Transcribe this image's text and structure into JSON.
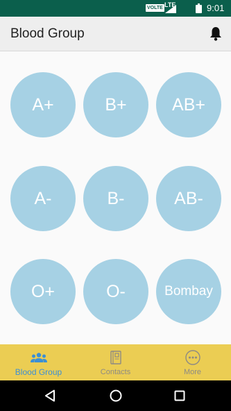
{
  "status_bar": {
    "volte": "VOLTE",
    "network": "LTE",
    "time": "9:01",
    "icons": [
      "volte-icon",
      "signal-icon",
      "battery-icon"
    ]
  },
  "app_bar": {
    "title": "Blood Group",
    "notification_icon": "bell-icon"
  },
  "blood_groups": [
    "A+",
    "B+",
    "AB+",
    "A-",
    "B-",
    "AB-",
    "O+",
    "O-",
    "Bombay"
  ],
  "bottom_nav": {
    "items": [
      {
        "label": "Blood Group",
        "icon": "people-icon",
        "active": true
      },
      {
        "label": "Contacts",
        "icon": "contacts-book-icon",
        "active": false
      },
      {
        "label": "More",
        "icon": "more-icon",
        "active": false
      }
    ]
  },
  "colors": {
    "status_bar": "#0b5f4c",
    "app_bar": "#eeeeee",
    "circle": "#a6d1e4",
    "bottom_nav": "#ebcd53",
    "active_tab": "#3b8fd5",
    "inactive_tab": "#8d8a84"
  }
}
